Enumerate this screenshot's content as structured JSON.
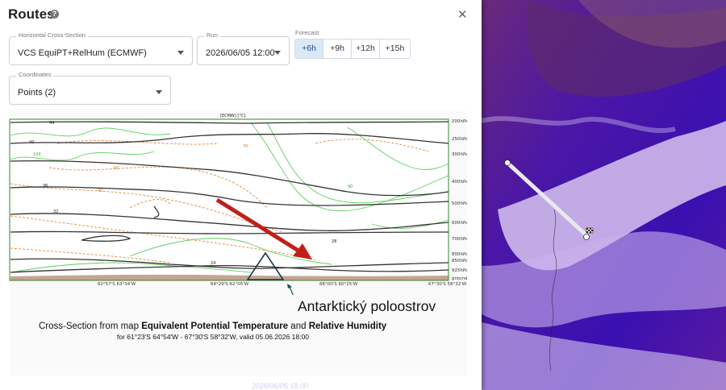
{
  "panel": {
    "title": "Routes",
    "horizontal_cross_section": {
      "label": "Horizontal Cross-Section",
      "value": "VCS EquiPT+RelHum (ECMWF)"
    },
    "run": {
      "label": "Run",
      "value": "2026/06/05 12:00"
    },
    "forecast": {
      "label": "Forecast",
      "options": [
        "+6h",
        "+9h",
        "+12h",
        "+15h"
      ],
      "selected": "+6h"
    },
    "coordinates": {
      "label": "Coordinates",
      "value": "Points (2)"
    }
  },
  "cross_section": {
    "chart_title": "[ECMW] [°C]",
    "pressure_levels": [
      "200hPa",
      "250hPa",
      "300hPa",
      "400hPa",
      "500hPa",
      "600hPa",
      "700hPa",
      "800hPa",
      "850hPa",
      "925hPa",
      "ground"
    ],
    "x_ticks": [
      "62°57'S 63°34'W",
      "64°29'S 62°05'W",
      "66°00'S 60°25'W",
      "67°30'S 58°32'W"
    ],
    "contour_labels": [
      "44",
      "40",
      "36",
      "32",
      "28",
      "24",
      "100",
      "90",
      "70",
      "60",
      "40"
    ],
    "annotation": "Antarktický poloostrov",
    "caption_prefix": "Cross-Section from map ",
    "caption_bold1": "Equivalent Potential Temperature",
    "caption_and": " and ",
    "caption_bold2": "Relative Humidity",
    "caption_line2": "for 61°23'S 64°54'W - 67°30'S 58°32'W, valid 05.06.2026 18:00"
  },
  "map": {
    "bottom_stamp": "2026/06/05 18:00"
  },
  "colors": {
    "accent": "#1a4d8f",
    "active_bg": "#dbe9f7",
    "map_bg": "#3a0f8c",
    "arrow": "#c0201a",
    "contour_theta": "#333333",
    "contour_rh": "#4cc94c",
    "contour_temp": "#e08a3c"
  },
  "icons": [
    "help-icon",
    "close-icon",
    "chevron-down-icon",
    "checkered-flag-icon"
  ]
}
